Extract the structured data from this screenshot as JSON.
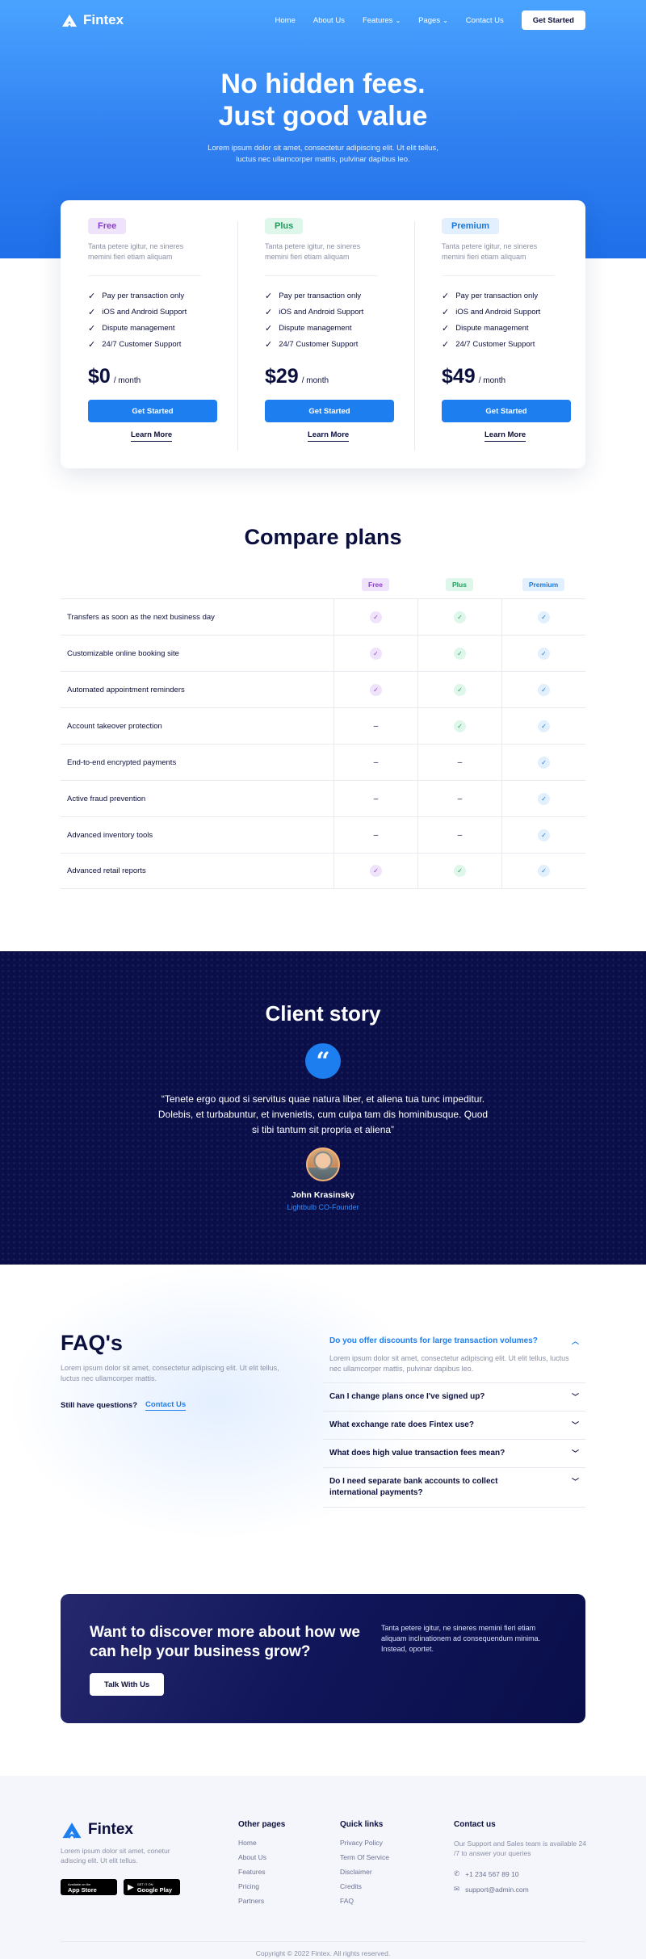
{
  "nav": {
    "brand": "Fintex",
    "links": [
      {
        "label": "Home",
        "dropdown": false
      },
      {
        "label": "About Us",
        "dropdown": false
      },
      {
        "label": "Features",
        "dropdown": true
      },
      {
        "label": "Pages",
        "dropdown": true
      },
      {
        "label": "Contact Us",
        "dropdown": false
      }
    ],
    "cta": "Get Started"
  },
  "hero": {
    "title_line1": "No hidden fees.",
    "title_line2": "Just good value",
    "sub_line1": "Lorem ipsum dolor sit amet, consectetur adipiscing elit. Ut elit tellus,",
    "sub_line2": "luctus nec ullamcorper mattis, pulvinar dapibus leo."
  },
  "plans": [
    {
      "name": "Free",
      "desc": "Tanta petere igitur, ne sineres memini fieri etiam aliquam",
      "features": [
        "Pay per transaction only",
        "iOS and Android Support",
        "Dispute management",
        "24/7 Customer Support"
      ],
      "price": "$0",
      "per": "/ month",
      "button": "Get Started",
      "link": "Learn More"
    },
    {
      "name": "Plus",
      "desc": "Tanta petere igitur, ne sineres memini fieri etiam aliquam",
      "features": [
        "Pay per transaction only",
        "iOS and Android Support",
        "Dispute management",
        "24/7 Customer Support"
      ],
      "price": "$29",
      "per": "/ month",
      "button": "Get Started",
      "link": "Learn More"
    },
    {
      "name": "Premium",
      "desc": "Tanta petere igitur, ne sineres memini fieri etiam aliquam",
      "features": [
        "Pay per transaction only",
        "iOS and Android Support",
        "Dispute management",
        "24/7 Customer Support"
      ],
      "price": "$49",
      "per": "/ month",
      "button": "Get Started",
      "link": "Learn More"
    }
  ],
  "compare": {
    "title": "Compare plans",
    "columns": [
      "Free",
      "Plus",
      "Premium"
    ],
    "rows": [
      {
        "label": "Transfers as soon as the next business day",
        "values": [
          true,
          true,
          true
        ]
      },
      {
        "label": "Customizable online booking site",
        "values": [
          true,
          true,
          true
        ]
      },
      {
        "label": "Automated appointment reminders",
        "values": [
          true,
          true,
          true
        ]
      },
      {
        "label": "Account takeover protection",
        "values": [
          false,
          true,
          true
        ]
      },
      {
        "label": "End-to-end encrypted payments",
        "values": [
          false,
          false,
          true
        ]
      },
      {
        "label": "Active fraud prevention",
        "values": [
          false,
          false,
          true
        ]
      },
      {
        "label": "Advanced inventory tools",
        "values": [
          false,
          false,
          true
        ]
      },
      {
        "label": "Advanced retail reports",
        "values": [
          true,
          true,
          true
        ]
      }
    ],
    "dash": "–"
  },
  "story": {
    "title": "Client story",
    "quote_icon": "quote-icon",
    "quote": "“Tenete ergo quod si servitus quae natura liber, et aliena tua tunc impeditur. Dolebis, et turbabuntur, et invenietis, cum culpa tam dis hominibusque. Quod si tibi tantum sit propria et aliena”",
    "author": "John Krasinsky",
    "role": "Lightbulb CO-Founder"
  },
  "faq": {
    "title": "FAQ's",
    "sub": "Lorem ipsum dolor sit amet, consectetur adipiscing elit. Ut elit tellus, luctus nec ullamcorper mattis.",
    "still": "Still have questions?",
    "contact": "Contact Us",
    "items": [
      {
        "q": "Do you offer discounts for large transaction volumes?",
        "a": "Lorem ipsum dolor sit amet, consectetur adipiscing elit. Ut elit tellus, luctus nec ullamcorper mattis, pulvinar dapibus leo.",
        "open": true
      },
      {
        "q": "Can I change plans once I've signed up?",
        "a": "",
        "open": false
      },
      {
        "q": "What exchange rate does Fintex use?",
        "a": "",
        "open": false
      },
      {
        "q": "What does high value transaction fees mean?",
        "a": "",
        "open": false
      },
      {
        "q": "Do I need separate bank accounts to collect international payments?",
        "a": "",
        "open": false
      }
    ]
  },
  "cta": {
    "title": "Want to discover more about how we can help your business grow?",
    "button": "Talk With Us",
    "text": "Tanta petere igitur, ne sineres memini fieri etiam aliquam inclinationem ad consequendum minima. Instead, oportet."
  },
  "footer": {
    "brand": "Fintex",
    "desc": "Lorem ipsum dolor sit amet, conetur adiscing elit. Ut elit tellus.",
    "appstore_small": "Available on the",
    "appstore": "App Store",
    "googleplay_small": "GET IT ON",
    "googleplay": "Google Play",
    "col1_title": "Other pages",
    "col1": [
      "Home",
      "About Us",
      "Features",
      "Pricing",
      "Partners"
    ],
    "col2_title": "Quick links",
    "col2": [
      "Privacy Policy",
      "Term Of Service",
      "Disclaimer",
      "Credits",
      "FAQ"
    ],
    "contact_title": "Contact us",
    "contact_text": "Our Support and Sales team is available 24 /7 to answer your queries",
    "phone": "+1 234 567 89 10",
    "email": "support@admin.com",
    "copyright": "Copyright © 2022 Fintex. All rights reserved."
  },
  "colors": {
    "accent": "#1d7ef0",
    "navy": "#0a0f4a",
    "free": "#8a3fc7",
    "plus": "#1f9d5b",
    "premium": "#1b78e0"
  }
}
